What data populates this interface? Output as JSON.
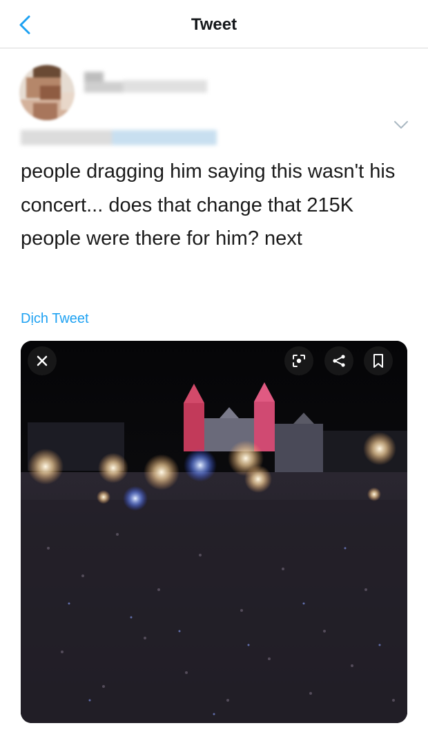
{
  "header": {
    "title": "Tweet",
    "back_icon": "chevron-left-icon"
  },
  "tweet": {
    "text": "people dragging him saying this wasn't his concert... does that change that 215K people were there for him? next",
    "translate_label": "Dịch Tweet",
    "more_icon": "chevron-down-icon"
  },
  "media": {
    "icons": [
      "close-icon",
      "lens-icon",
      "share-icon",
      "bookmark-icon"
    ]
  },
  "colors": {
    "accent": "#1da1f2",
    "text": "#14171a",
    "divider": "#d9d9d9"
  }
}
